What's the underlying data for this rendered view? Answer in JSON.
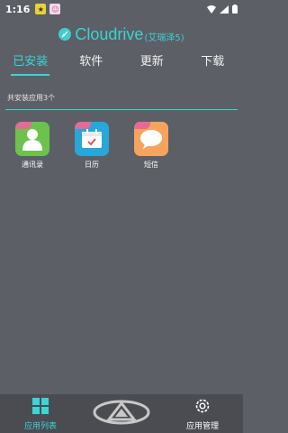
{
  "status_bar": {
    "time": "1:16"
  },
  "header": {
    "brand": "Cloudrive",
    "subtitle": "(艾瑞泽5)"
  },
  "tabs": [
    {
      "label": "已安装",
      "active": true
    },
    {
      "label": "软件",
      "active": false
    },
    {
      "label": "更新",
      "active": false
    },
    {
      "label": "下载",
      "active": false
    }
  ],
  "installed_count": "共安装应用3个",
  "apps": [
    {
      "label": "通讯录",
      "icon": "contacts-icon",
      "color": "#6cc24a"
    },
    {
      "label": "日历",
      "icon": "calendar-icon",
      "color": "#27a8d8"
    },
    {
      "label": "短信",
      "icon": "message-icon",
      "color": "#f6a45d"
    }
  ],
  "bottom_nav": {
    "app_list_label": "应用列表",
    "app_manage_label": "应用管理"
  },
  "colors": {
    "accent": "#3ad6d6",
    "background": "#5c5f66",
    "bottom_bar": "#4a4c52"
  }
}
